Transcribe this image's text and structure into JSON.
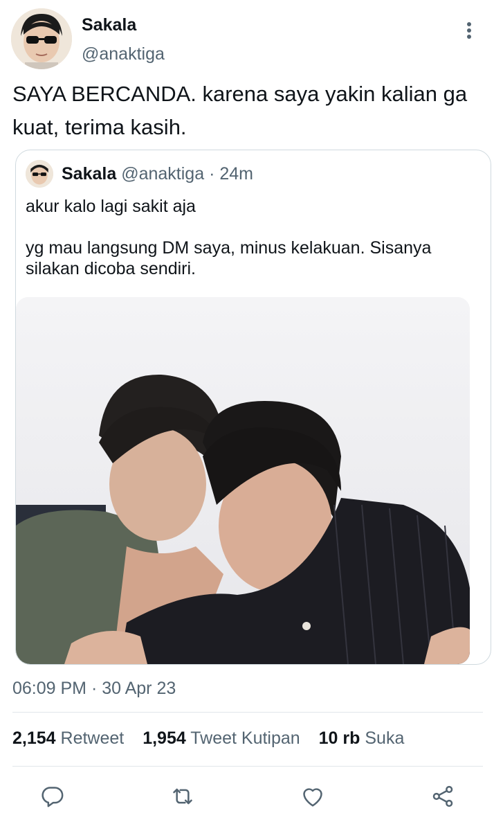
{
  "author": {
    "name": "Sakala",
    "handle": "@anaktiga"
  },
  "tweet": {
    "text": "SAYA BERCANDA. karena saya yakin kalian ga kuat, terima kasih."
  },
  "quoted": {
    "name": "Sakala",
    "handle": "@anaktiga",
    "separator": "·",
    "time": "24m",
    "text": "akur kalo lagi sakit aja\n\nyg mau langsung DM saya, minus kelakuan. Sisanya silakan dicoba sendiri."
  },
  "timestamp": "06:09 PM · 30 Apr 23",
  "stats": {
    "retweets_count": "2,154",
    "retweets_label": "Retweet",
    "quotes_count": "1,954",
    "quotes_label": "Tweet Kutipan",
    "likes_count": "10 rb",
    "likes_label": "Suka"
  },
  "icons": {
    "more": "more-vertical-icon",
    "reply": "reply-icon",
    "retweet": "retweet-icon",
    "like": "like-icon",
    "share": "share-icon"
  },
  "colors": {
    "text": "#0f1419",
    "secondary": "#536471",
    "border": "#cfd9de",
    "divider": "#e1e6ea"
  }
}
